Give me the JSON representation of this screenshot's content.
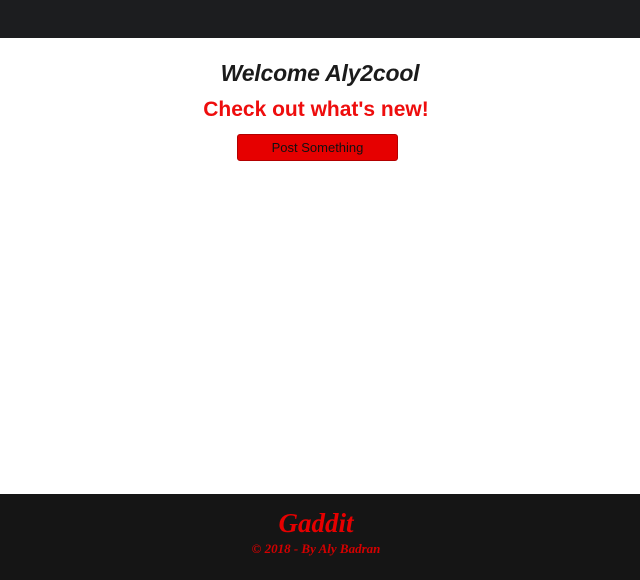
{
  "main": {
    "welcome_text": "Welcome Aly2cool",
    "news_heading": "Check out what's new!",
    "post_button_label": "Post Something"
  },
  "footer": {
    "brand": "Gaddit",
    "copyright": "© 2018 - By Aly Badran"
  },
  "colors": {
    "accent": "#e60000",
    "dark_bar": "#1c1d1f",
    "footer_bg": "#151515"
  }
}
